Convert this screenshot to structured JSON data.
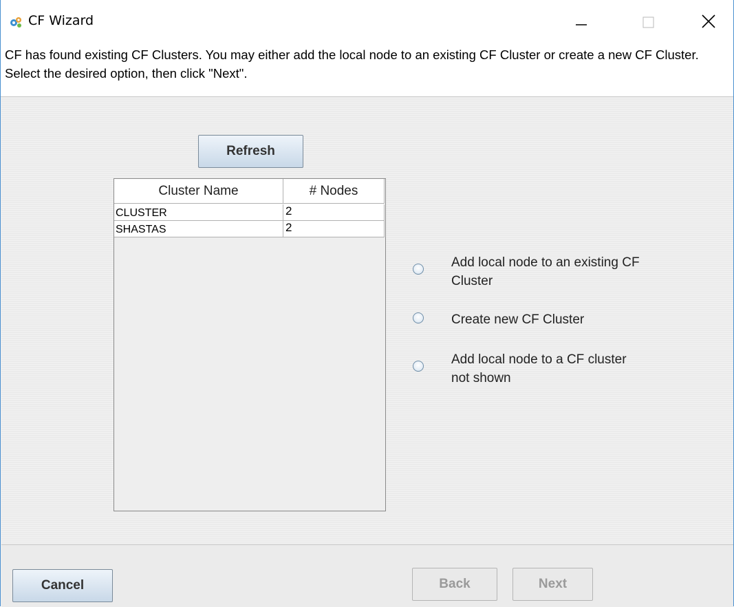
{
  "window": {
    "title": "CF Wizard",
    "icon": "cf-gear-icon",
    "controls": [
      "minimize-icon",
      "maximize-icon",
      "close-icon"
    ]
  },
  "description": "CF has found existing CF Clusters. You may either add the local node to an existing CF Cluster or create a new CF Cluster. Select the desired option, then click \"Next\".",
  "refresh_label": "Refresh",
  "table": {
    "columns": [
      "Cluster Name",
      "# Nodes"
    ],
    "rows": [
      {
        "name": "CLUSTER",
        "nodes": "2"
      },
      {
        "name": "SHASTAS",
        "nodes": "2"
      }
    ]
  },
  "options": [
    {
      "label": "Add local node to an existing CF Cluster",
      "selected": false
    },
    {
      "label": "Create new CF Cluster",
      "selected": false
    },
    {
      "label": "Add local node to a CF cluster not shown",
      "selected": false
    }
  ],
  "buttons": {
    "cancel": "Cancel",
    "back": "Back",
    "next": "Next"
  },
  "colors": {
    "window_border": "#4a90d0",
    "button_gradient_top": "#eef4fa",
    "button_gradient_bottom": "#c8d8e8",
    "disabled_text": "#9a9a9a"
  }
}
